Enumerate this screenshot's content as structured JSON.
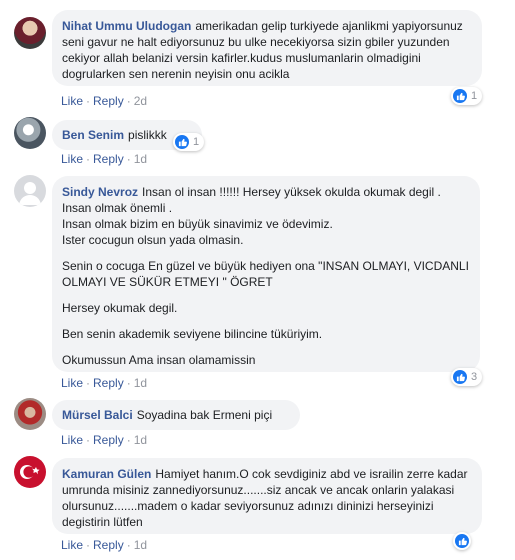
{
  "actions": {
    "like": "Like",
    "reply": "Reply",
    "separator": "·"
  },
  "colors": {
    "name": "#385898",
    "bubble": "#f2f3f5",
    "like_icon": "#1877f2"
  },
  "comments": [
    {
      "author": "Nihat Ummu Uludogan",
      "text": "amerikadan gelip turkiyede ajanlikmi yapiyorsunuz seni gavur ne halt ediyorsunuz bu ulke necekiyorsa sizin gbiler yuzunden cekiyor allah belanizi versin kafirler.kudus muslumanlarin olmadigini dogrularken sen nerenin neyisin onu acikla",
      "time": "2d",
      "reactions": "1"
    },
    {
      "author": "Ben Senim",
      "text": "pislikkk",
      "time": "1d",
      "reactions": "1"
    },
    {
      "author": "Sindy Nevroz",
      "paragraphs": [
        "Insan ol insan !!!!!! Hersey yüksek okulda okumak degil . Insan olmak önemli .\nInsan olmak bizim en büyük sinavimiz ve ödevimiz.\nIster cocugun olsun yada olmasin.",
        "Senin o cocuga En güzel ve büyük hediyen ona \"INSAN OLMAYI, VICDANLI OLMAYI VE SÜKÜR ETMEYI \" ÖGRET",
        "Hersey okumak degil.",
        "Ben senin akademik seviyene bilincine tüküriyim.",
        "Okumussun Ama insan olamamissin"
      ],
      "time": "1d",
      "reactions": "3"
    },
    {
      "author": "Mürsel Balci",
      "text": "Soyadina bak Ermeni piçi",
      "time": "1d",
      "reactions": ""
    },
    {
      "author": "Kamuran Gülen",
      "text": "Hamiyet hanım.O cok sevdiginiz abd ve israilin zerre kadar umrunda misiniz zannediyorsunuz.......siz ancak ve ancak onlarin yalakasi olursunuz.......madem o kadar seviyorsunuz adınızı dininizi herseyinizi degistirin lütfen",
      "time": "1d",
      "reactions": ""
    }
  ]
}
